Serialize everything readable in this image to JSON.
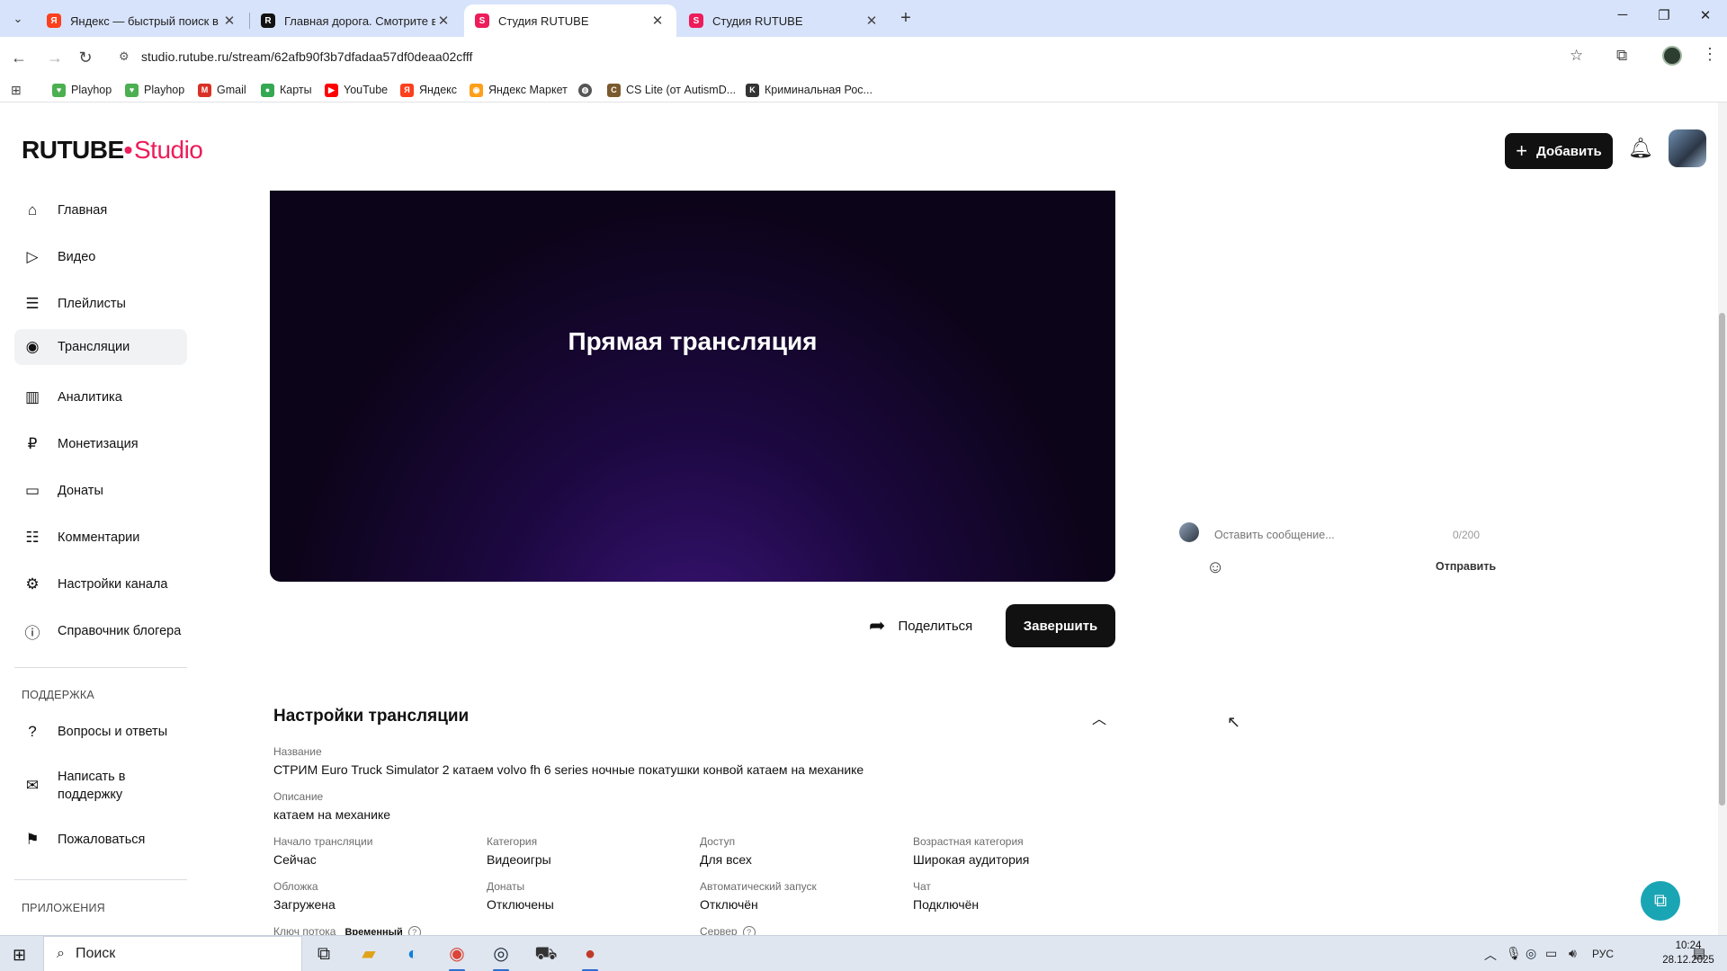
{
  "browser": {
    "tabs": [
      {
        "title": "Яндекс — быстрый поиск в и",
        "favicon": "Я",
        "color": "#fc3f1d"
      },
      {
        "title": "Главная дорога. Смотрите ви",
        "favicon": "R",
        "color": "#121212"
      },
      {
        "title": "Студия RUTUBE",
        "favicon": "S",
        "color": "#ed1c5a"
      },
      {
        "title": "Студия RUTUBE",
        "favicon": "S",
        "color": "#ed1c5a"
      }
    ],
    "active_tab": 2,
    "url": "studio.rutube.ru/stream/62afb90f3b7dfadaa57df0deaa02cfff",
    "bookmarks": [
      {
        "label": "Playhop",
        "icon": "playhop-icon",
        "color": "#4caf50"
      },
      {
        "label": "Playhop",
        "icon": "playhop-icon",
        "color": "#4caf50"
      },
      {
        "label": "Gmail",
        "icon": "gmail-icon",
        "color": "#d93025"
      },
      {
        "label": "Карты",
        "icon": "maps-pin-icon",
        "color": "#34a853"
      },
      {
        "label": "YouTube",
        "icon": "youtube-icon",
        "color": "#ff0000"
      },
      {
        "label": "Яндекс",
        "icon": "yandex-icon",
        "color": "#fc3f1d"
      },
      {
        "label": "Яндекс Маркет",
        "icon": "market-icon",
        "color": "#ff9f1a"
      },
      {
        "label": "",
        "icon": "globe-icon",
        "color": "#555555"
      },
      {
        "label": "CS Lite (от AutismD...",
        "icon": "cs-icon",
        "color": "#7a5a2e"
      },
      {
        "label": "Криминальная Рос...",
        "icon": "crime-icon",
        "color": "#333333"
      }
    ]
  },
  "studio": {
    "logo_main": "RUTUBE",
    "logo_dot": "•",
    "logo_studio": "Studio",
    "add_button": "Добавить",
    "brand_color": "#ed1c5a"
  },
  "sidebar": {
    "items": [
      {
        "label": "Главная",
        "icon": "home-icon"
      },
      {
        "label": "Видео",
        "icon": "video-icon"
      },
      {
        "label": "Плейлисты",
        "icon": "playlists-icon"
      },
      {
        "label": "Трансляции",
        "icon": "broadcast-icon"
      },
      {
        "label": "Аналитика",
        "icon": "analytics-icon"
      },
      {
        "label": "Монетизация",
        "icon": "ruble-icon"
      },
      {
        "label": "Донаты",
        "icon": "wallet-icon"
      },
      {
        "label": "Комментарии",
        "icon": "comments-icon"
      },
      {
        "label": "Настройки канала",
        "icon": "settings-icon"
      },
      {
        "label": "Справочник блогера",
        "icon": "info-icon"
      }
    ],
    "active_index": 3,
    "support_heading": "ПОДДЕРЖКА",
    "support_items": [
      {
        "label": "Вопросы и ответы",
        "icon": "question-icon"
      },
      {
        "label": "Написать в поддержку",
        "icon": "mail-icon"
      },
      {
        "label": "Пожаловаться",
        "icon": "flag-icon"
      }
    ],
    "apps_heading": "ПРИЛОЖЕНИЯ"
  },
  "player": {
    "title": "Прямая трансляция",
    "share_label": "Поделиться",
    "finish_label": "Завершить"
  },
  "chat": {
    "placeholder": "Оставить сообщение...",
    "counter": "0/200",
    "send_label": "Отправить"
  },
  "settings": {
    "title": "Настройки трансляции",
    "name_label": "Название",
    "name_value": "СТРИМ Euro Truck Simulator 2 катаем volvo fh 6 series ночные покатушки конвой катаем на механике",
    "description_label": "Описание",
    "description_value": "катаем на механике",
    "fields": [
      {
        "label": "Начало трансляции",
        "value": "Сейчас"
      },
      {
        "label": "Категория",
        "value": "Видеоигры"
      },
      {
        "label": "Доступ",
        "value": "Для всех"
      },
      {
        "label": "Возрастная категория",
        "value": "Широкая аудитория"
      },
      {
        "label": "Обложка",
        "value": "Загружена"
      },
      {
        "label": "Донаты",
        "value": "Отключены"
      },
      {
        "label": "Автоматический запуск",
        "value": "Отключён"
      },
      {
        "label": "Чат",
        "value": "Подключён"
      }
    ],
    "stream_key_label": "Ключ потока",
    "stream_key_badge": "Временный",
    "server_label": "Сервер"
  },
  "taskbar": {
    "search_label": "Поиск",
    "language": "РУС",
    "time": "10:24",
    "date": "28.12.2025"
  }
}
